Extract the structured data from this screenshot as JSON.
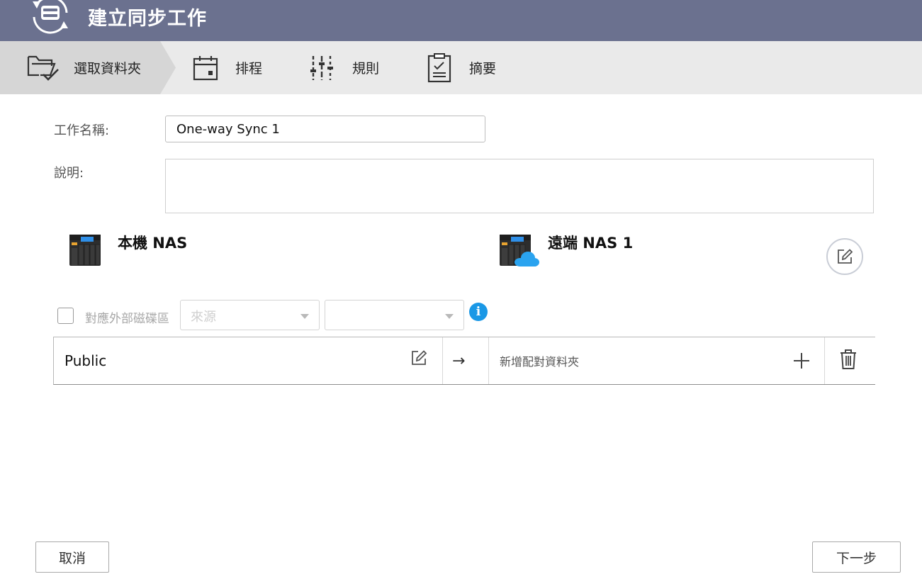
{
  "window": {
    "title": "建立同步工作"
  },
  "steps": [
    {
      "label": "選取資料夾",
      "icon": "folder-check-icon",
      "active": true
    },
    {
      "label": "排程",
      "icon": "calendar-icon",
      "active": false
    },
    {
      "label": "規則",
      "icon": "sliders-icon",
      "active": false
    },
    {
      "label": "摘要",
      "icon": "clipboard-icon",
      "active": false
    }
  ],
  "form": {
    "job_name_label": "工作名稱:",
    "job_name_value": "One-way Sync 1",
    "description_label": "說明:",
    "description_value": ""
  },
  "local": {
    "title": "本機 NAS",
    "icon": "nas-icon"
  },
  "remote": {
    "title": "遠端 NAS 1",
    "icon": "cloud-nas-icon",
    "edit_icon": "edit-icon"
  },
  "external": {
    "checkbox_label": "對應外部磁碟區",
    "checked": false,
    "source_placeholder": "來源",
    "target_value": ""
  },
  "mapping": {
    "source_folder": "Public",
    "arrow": "→",
    "target_placeholder": "新增配對資料夾",
    "add_symbol": "+"
  },
  "buttons": {
    "cancel": "取消",
    "next": "下一步"
  },
  "colors": {
    "titlebar": "#6b718f",
    "stepbar": "#eaeaea",
    "step_active": "#d6d6d6",
    "info": "#1a98e6",
    "cloud": "#2aa3ef"
  }
}
